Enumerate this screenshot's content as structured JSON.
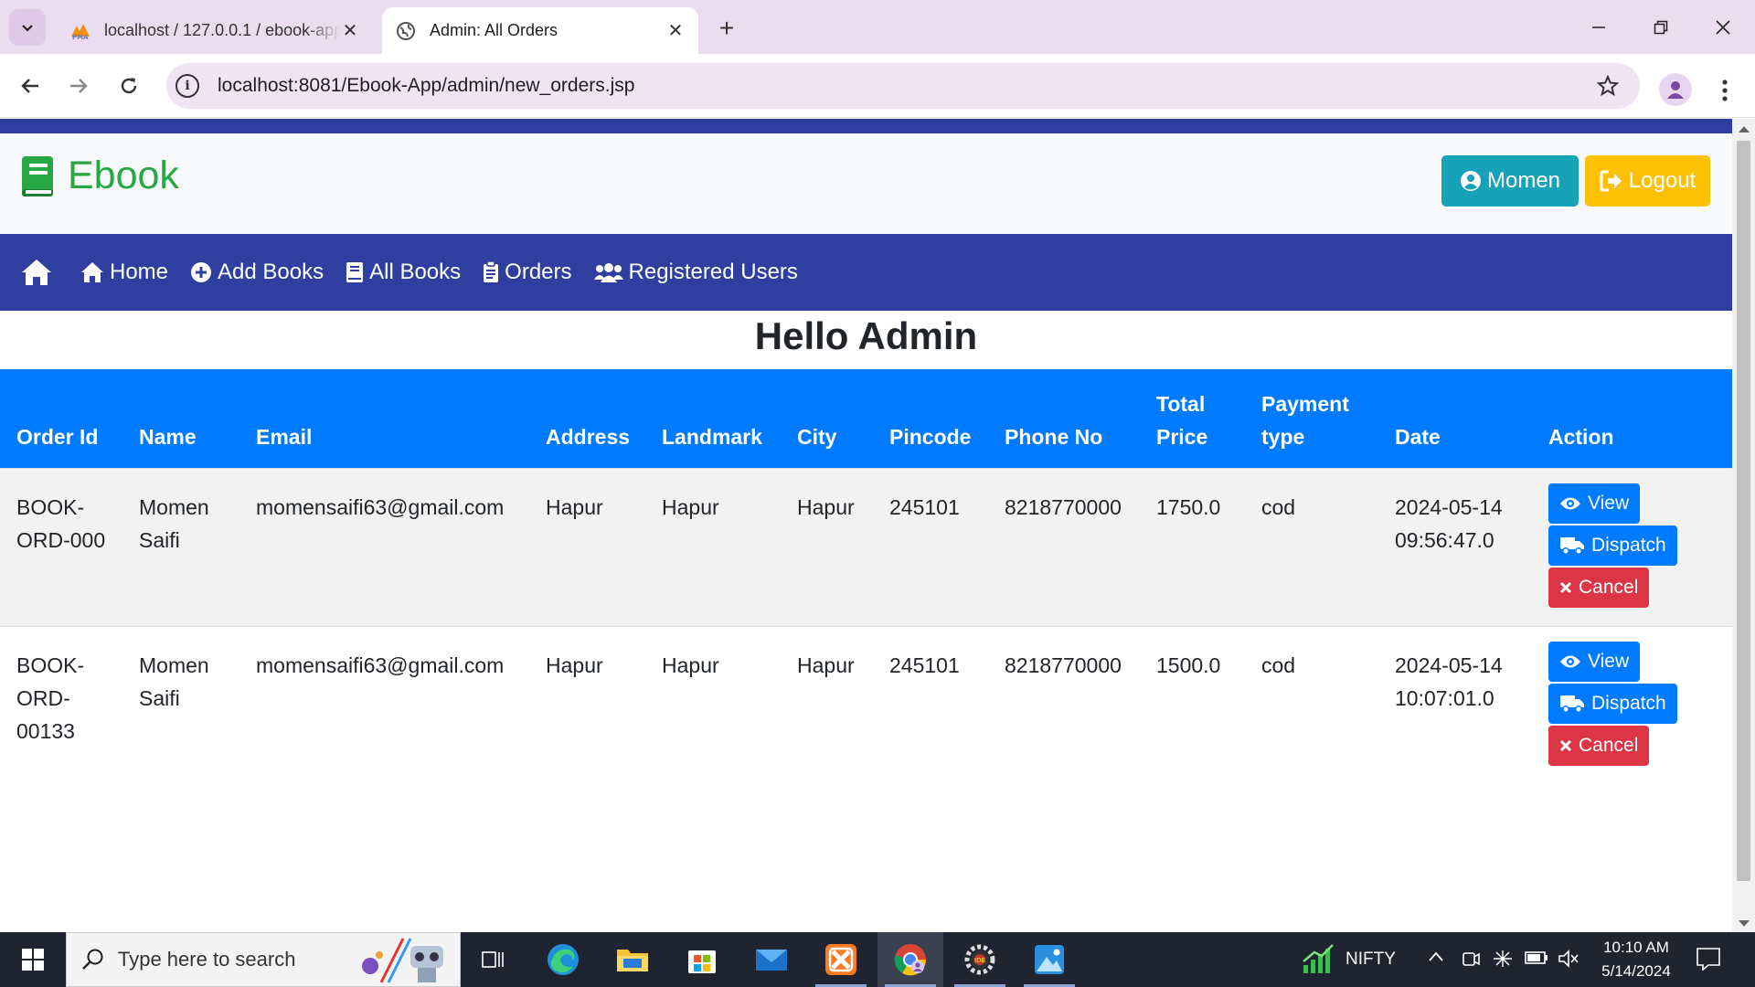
{
  "browser": {
    "tabs": [
      {
        "title": "localhost / 127.0.0.1 / ebook-app",
        "favicon": "phpmyadmin-icon",
        "active": false
      },
      {
        "title": "Admin: All Orders",
        "favicon": "globe-icon",
        "active": true
      }
    ],
    "url": "localhost:8081/Ebook-App/admin/new_orders.jsp"
  },
  "header": {
    "brand": "Ebook",
    "user_button": "Momen",
    "logout_button": "Logout"
  },
  "nav": {
    "items": [
      {
        "label": "Home",
        "icon": "home-icon"
      },
      {
        "label": "Add Books",
        "icon": "plus-circle-icon"
      },
      {
        "label": "All Books",
        "icon": "book-icon"
      },
      {
        "label": "Orders",
        "icon": "clipboard-icon"
      },
      {
        "label": "Registered Users",
        "icon": "users-icon"
      }
    ]
  },
  "page": {
    "heading": "Hello Admin"
  },
  "table": {
    "headers": [
      "Order Id",
      "Name",
      "Email",
      "Address",
      "Landmark",
      "City",
      "Pincode",
      "Phone No",
      "Total Price",
      "Payment type",
      "Date",
      "Action"
    ],
    "rows": [
      {
        "order_id": "BOOK-ORD-000",
        "name": "Momen Saifi",
        "email": "momensaifi63@gmail.com",
        "address": "Hapur",
        "landmark": "Hapur",
        "city": "Hapur",
        "pincode": "245101",
        "phone": "8218770000",
        "total_price": "1750.0",
        "payment": "cod",
        "date": "2024-05-14 09:56:47.0"
      },
      {
        "order_id": "BOOK-ORD-00133",
        "name": "Momen Saifi",
        "email": "momensaifi63@gmail.com",
        "address": "Hapur",
        "landmark": "Hapur",
        "city": "Hapur",
        "pincode": "245101",
        "phone": "8218770000",
        "total_price": "1500.0",
        "payment": "cod",
        "date": "2024-05-14 10:07:01.0"
      }
    ],
    "actions": {
      "view": "View",
      "dispatch": "Dispatch",
      "cancel": "Cancel"
    }
  },
  "taskbar": {
    "search_placeholder": "Type here to search",
    "ticker": "NIFTY",
    "time": "10:10 AM",
    "date": "5/14/2024"
  },
  "colors": {
    "nav_bg": "#303f9f",
    "table_header": "#007bff",
    "brand_green": "#28a745",
    "user_btn": "#17a2b8",
    "logout_btn": "#ffc107",
    "cancel_btn": "#dc3545"
  }
}
